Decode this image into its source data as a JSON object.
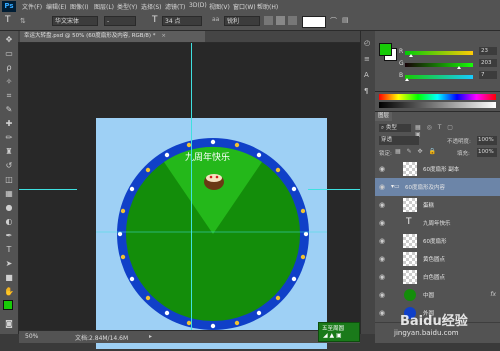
{
  "app": {
    "logo": "Ps"
  },
  "menu": [
    "文件(F)",
    "编辑(E)",
    "图像(I)",
    "图层(L)",
    "类型(Y)",
    "选择(S)",
    "滤镜(T)",
    "3D(D)",
    "视图(V)",
    "窗口(W)",
    "帮助(H)"
  ],
  "options": {
    "font_family": "华文宋体",
    "font_style": "-",
    "font_size": "34 点",
    "antialias": "锐利"
  },
  "document": {
    "tab_title": "幸运大转盘.psd @ 50% (60度扇形及内容, RGB/8) *",
    "close": "×",
    "banner_text": "九周年快乐",
    "zoom": "50%",
    "doc_info": "文档:2.84M/14.6M"
  },
  "color_panel": {
    "r_label": "R",
    "r_value": "23",
    "g_label": "G",
    "g_value": "203",
    "b_label": "B",
    "b_value": "7",
    "r_fill": 0.09,
    "g_fill": 0.8,
    "b_fill": 0.03,
    "fg_color": "#17cb07"
  },
  "layers_panel": {
    "tab_label": "图层",
    "filter_label": "类型",
    "blend_mode": "穿透",
    "opacity_label": "不透明度:",
    "opacity_value": "100%",
    "lock_label": "锁定:",
    "fill_label": "填充:",
    "fill_value": "100%",
    "layers": [
      {
        "name": "60度扇形 副本",
        "selected": false
      },
      {
        "name": "60度扇形及内容",
        "selected": true
      },
      {
        "name": "蛋糕",
        "selected": false
      },
      {
        "name": "九周年快乐",
        "selected": false
      },
      {
        "name": "60度扇形",
        "selected": false
      },
      {
        "name": "黄色圆点",
        "selected": false
      },
      {
        "name": "白色圆点",
        "selected": false
      },
      {
        "name": "中圆",
        "selected": false
      },
      {
        "name": "外圆",
        "selected": false
      }
    ]
  },
  "mini_bridge": {
    "label": "五至周圆"
  },
  "watermark": {
    "brand": "Baidu经验",
    "url": "jingyan.baidu.com"
  }
}
